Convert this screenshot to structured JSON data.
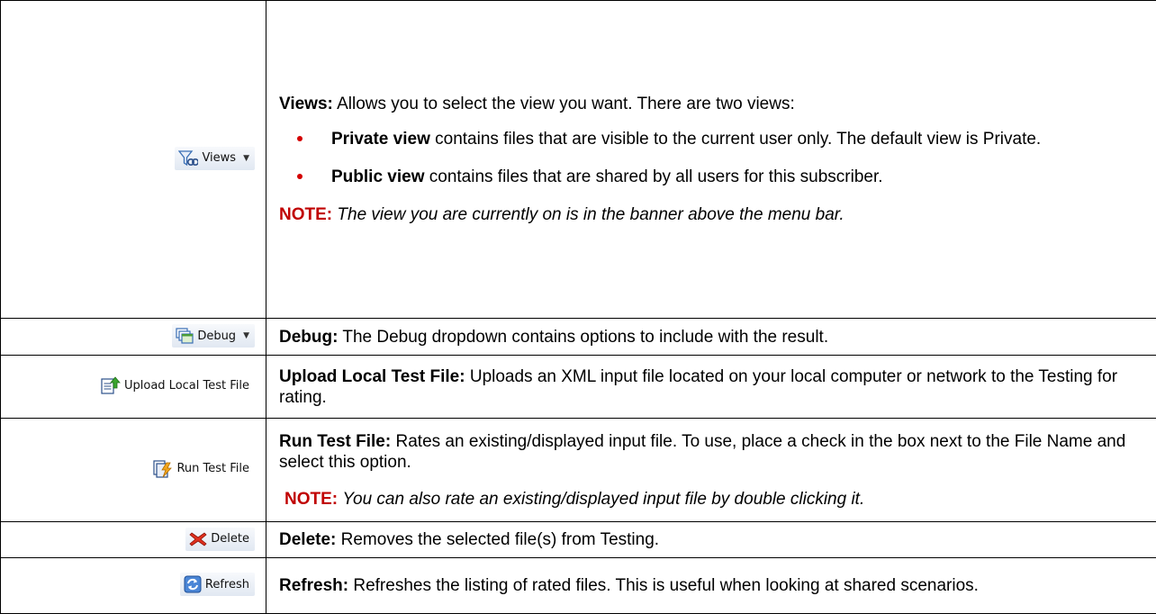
{
  "rows": [
    {
      "button": {
        "label": "Views",
        "icon": "views-filter-icon",
        "has_dropdown": true
      },
      "title": "Views:",
      "text": "Allows you to select the view you want. There are two views:",
      "bullets": [
        {
          "title": "Private view",
          "text": "contains files that are visible to the current user only. The default view is Private."
        },
        {
          "title": "Public view",
          "text": "contains files that are shared by all users for this subscriber."
        }
      ],
      "note": {
        "label": "NOTE:",
        "text": "The view you are currently on is in the banner above the menu bar."
      }
    },
    {
      "button": {
        "label": "Debug",
        "icon": "debug-window-icon",
        "has_dropdown": true
      },
      "title": "Debug:",
      "text": "The Debug  dropdown contains options to include with the result."
    },
    {
      "button": {
        "label": "Upload Local Test File",
        "icon": "upload-file-icon"
      },
      "title": "Upload Local Test File:",
      "text": "Uploads an XML input file located on your local computer or network to the Testing for rating."
    },
    {
      "button": {
        "label": "Run Test File",
        "icon": "run-file-icon"
      },
      "title": "Run Test File:",
      "text": "Rates an existing/displayed input file. To use, place a check in the box next to the File Name and select this option.",
      "note": {
        "label": "NOTE:",
        "text": "You can also rate an existing/displayed input file by double clicking it."
      }
    },
    {
      "button": {
        "label": "Delete",
        "icon": "delete-x-icon"
      },
      "title": "Delete:",
      "text": "Removes the selected file(s) from Testing."
    },
    {
      "button": {
        "label": "Refresh",
        "icon": "refresh-icon"
      },
      "title": "Refresh:",
      "text": "Refreshes the listing of rated files. This is useful when looking at shared scenarios."
    }
  ],
  "colors": {
    "note": "#c00000",
    "bullet": "#d40000",
    "button_bg": "#e1e8f2"
  }
}
